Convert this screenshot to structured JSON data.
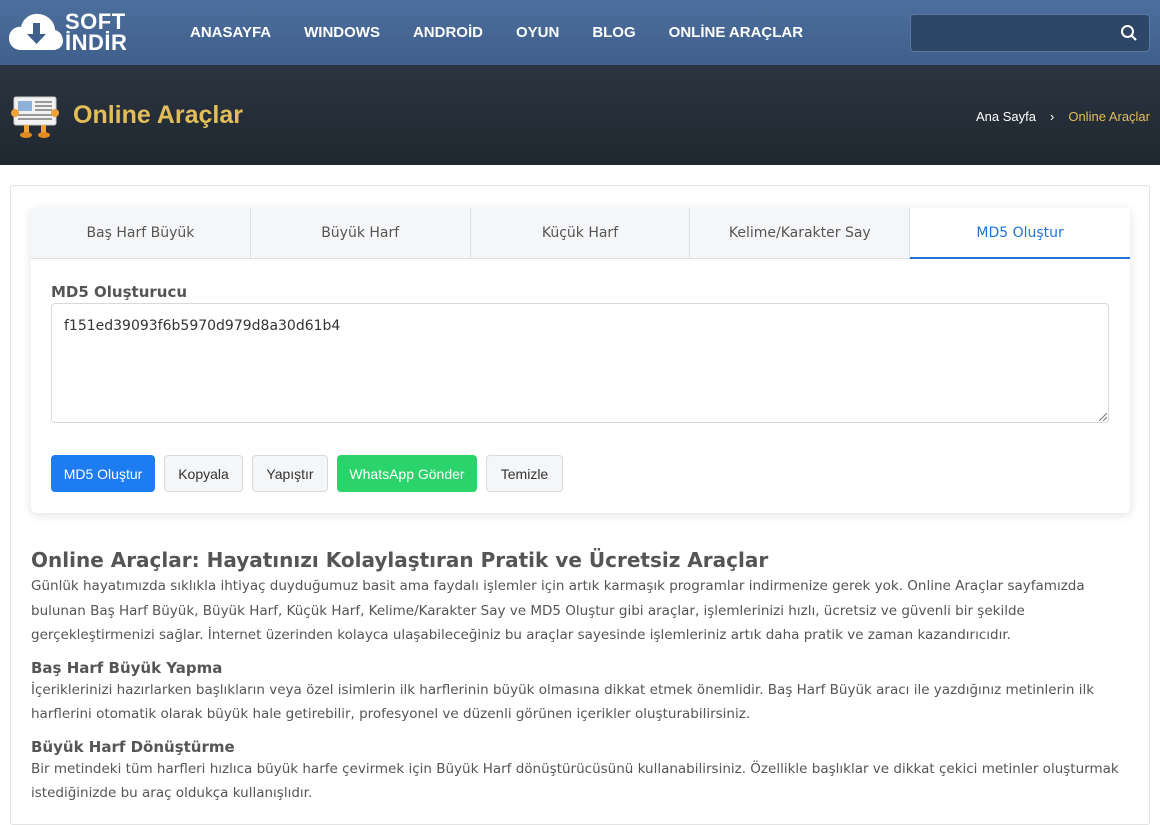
{
  "nav": {
    "logo_line1": "SOFT",
    "logo_line2": "İNDİR",
    "links": [
      "ANASAYFA",
      "WINDOWS",
      "ANDROİD",
      "OYUN",
      "BLOG",
      "ONLİNE ARAÇLAR"
    ],
    "search_placeholder": ""
  },
  "header": {
    "title": "Online Araçlar",
    "breadcrumb_home": "Ana Sayfa",
    "breadcrumb_sep": "›",
    "breadcrumb_current": "Online Araçlar"
  },
  "tabs": [
    "Baş Harf Büyük",
    "Büyük Harf",
    "Küçük Harf",
    "Kelime/Karakter Say",
    "MD5 Oluştur"
  ],
  "active_tab_index": 4,
  "tool": {
    "label": "MD5 Oluşturucu",
    "value": "f151ed39093f6b5970d979d8a30d61b4",
    "buttons": {
      "generate": "MD5 Oluştur",
      "copy": "Kopyala",
      "paste": "Yapıştır",
      "whatsapp": "WhatsApp Gönder",
      "clear": "Temizle"
    }
  },
  "article": {
    "h1": "Online Araçlar: Hayatınızı Kolaylaştıran Pratik ve Ücretsiz Araçlar",
    "p1": "Günlük hayatımızda sıklıkla ihtiyaç duyduğumuz basit ama faydalı işlemler için artık karmaşık programlar indirmenize gerek yok. Online Araçlar sayfamızda bulunan Baş Harf Büyük, Büyük Harf, Küçük Harf, Kelime/Karakter Say ve MD5 Oluştur gibi araçlar, işlemlerinizi hızlı, ücretsiz ve güvenli bir şekilde gerçekleştirmenizi sağlar. İnternet üzerinden kolayca ulaşabileceğiniz bu araçlar sayesinde işlemleriniz artık daha pratik ve zaman kazandırıcıdır.",
    "h2a": "Baş Harf Büyük Yapma",
    "p2": "İçeriklerinizi hazırlarken başlıkların veya özel isimlerin ilk harflerinin büyük olmasına dikkat etmek önemlidir. Baş Harf Büyük aracı ile yazdığınız metinlerin ilk harflerini otomatik olarak büyük hale getirebilir, profesyonel ve düzenli görünen içerikler oluşturabilirsiniz.",
    "h2b": "Büyük Harf Dönüştürme",
    "p3": "Bir metindeki tüm harfleri hızlıca büyük harfe çevirmek için Büyük Harf dönüştürücüsünü kullanabilirsiniz. Özellikle başlıklar ve dikkat çekici metinler oluşturmak istediğinizde bu araç oldukça kullanışlıdır."
  },
  "colors": {
    "nav_bg": "#4d6f9d",
    "header_bg": "#2c3540",
    "accent_gold": "#e2bd58",
    "primary_blue": "#1d7cf2",
    "whatsapp_green": "#2bd36b"
  }
}
